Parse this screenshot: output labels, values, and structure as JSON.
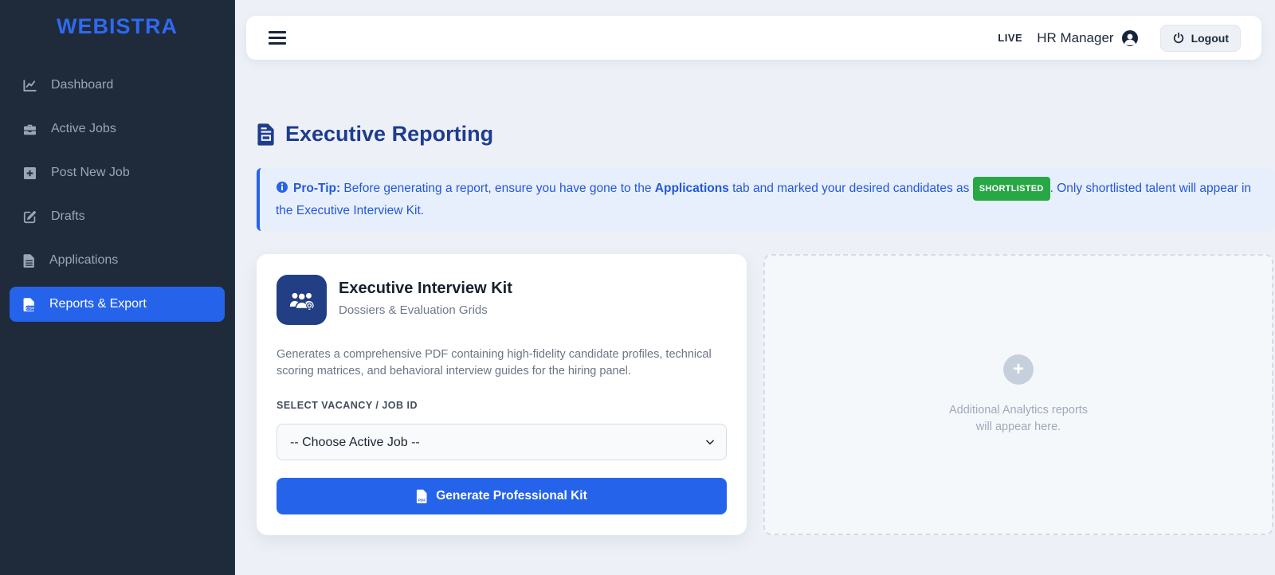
{
  "brand": {
    "name": "WEBISTRA"
  },
  "sidebar": {
    "items": [
      {
        "label": "Dashboard",
        "icon": "chart-line",
        "active": false
      },
      {
        "label": "Active Jobs",
        "icon": "briefcase",
        "active": false
      },
      {
        "label": "Post New Job",
        "icon": "plus-square",
        "active": false
      },
      {
        "label": "Drafts",
        "icon": "pen-square",
        "active": false
      },
      {
        "label": "Applications",
        "icon": "file-lines",
        "active": false
      },
      {
        "label": "Reports & Export",
        "icon": "file-csv",
        "active": true
      }
    ]
  },
  "topbar": {
    "status_label": "LIVE",
    "user_name": "HR Manager",
    "logout_label": "Logout"
  },
  "page": {
    "title": "Executive Reporting"
  },
  "protip": {
    "label": "Pro-Tip:",
    "text_1": " Before generating a report, ensure you have gone to the ",
    "bold_1": "Applications",
    "text_2": " tab and marked your desired candidates as ",
    "badge": "SHORTLISTED",
    "text_3": ". Only shortlisted talent will appear in the Executive Interview Kit."
  },
  "kit_card": {
    "title": "Executive Interview Kit",
    "subtitle": "Dossiers & Evaluation Grids",
    "description": "Generates a comprehensive PDF containing high-fidelity candidate profiles, technical scoring matrices, and behavioral interview guides for the hiring panel.",
    "select_label": "SELECT VACANCY / JOB ID",
    "select_value": "-- Choose Active Job --",
    "button_label": "Generate Professional Kit"
  },
  "placeholder": {
    "line_1": "Additional Analytics reports",
    "line_2": "will appear here."
  },
  "colors": {
    "primary_blue": "#2563eb",
    "logo_blue": "#2e6af0",
    "sidebar_bg": "#1f2a3b",
    "badge_green": "#28a745",
    "heading_navy": "#1e3c8f",
    "tile_navy": "#223e85",
    "page_bg": "#edf1f7",
    "alert_bg": "#e7effc"
  }
}
